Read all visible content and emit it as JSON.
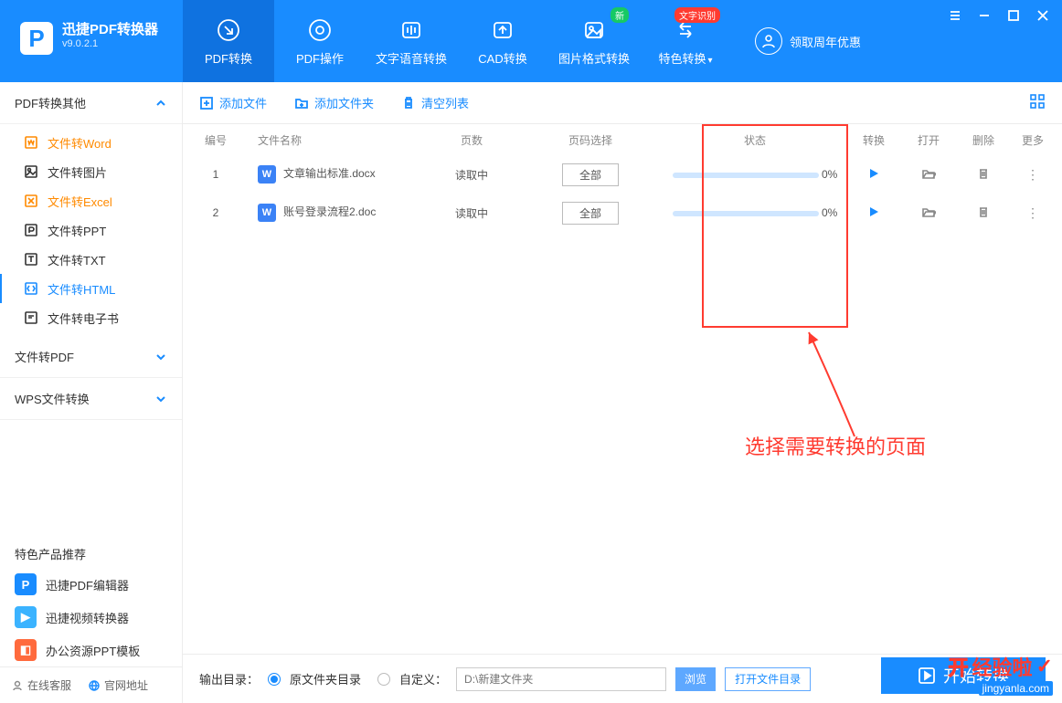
{
  "app": {
    "title": "迅捷PDF转换器",
    "version": "v9.0.2.1"
  },
  "nav": {
    "items": [
      {
        "label": "PDF转换"
      },
      {
        "label": "PDF操作"
      },
      {
        "label": "文字语音转换"
      },
      {
        "label": "CAD转换"
      },
      {
        "label": "图片格式转换"
      },
      {
        "label": "特色转换"
      }
    ],
    "badge_new": "新",
    "badge_ocr": "文字识别",
    "reward": "领取周年优惠"
  },
  "sidebar": {
    "groups": [
      {
        "label": "PDF转换其他"
      },
      {
        "label": "文件转PDF"
      },
      {
        "label": "WPS文件转换"
      }
    ],
    "items": [
      {
        "label": "文件转Word"
      },
      {
        "label": "文件转图片"
      },
      {
        "label": "文件转Excel"
      },
      {
        "label": "文件转PPT"
      },
      {
        "label": "文件转TXT"
      },
      {
        "label": "文件转HTML"
      },
      {
        "label": "文件转电子书"
      }
    ],
    "promo_title": "特色产品推荐",
    "promos": [
      {
        "label": "迅捷PDF编辑器",
        "color": "#198cff",
        "glyph": "P"
      },
      {
        "label": "迅捷视频转换器",
        "color": "#3bb3ff",
        "glyph": "▶"
      },
      {
        "label": "办公资源PPT模板",
        "color": "#ff6a3d",
        "glyph": "◧"
      }
    ],
    "footer": {
      "support": "在线客服",
      "site": "官网地址"
    }
  },
  "toolbar": {
    "add_file": "添加文件",
    "add_folder": "添加文件夹",
    "clear": "清空列表"
  },
  "table": {
    "headers": {
      "id": "编号",
      "name": "文件名称",
      "pages": "页数",
      "sel": "页码选择",
      "status": "状态",
      "convert": "转换",
      "open": "打开",
      "del": "删除",
      "more": "更多"
    },
    "rows": [
      {
        "id": "1",
        "name": "文章输出标准.docx",
        "pages": "读取中",
        "sel": "全部",
        "status": "0%"
      },
      {
        "id": "2",
        "name": "账号登录流程2.doc",
        "pages": "读取中",
        "sel": "全部",
        "status": "0%"
      }
    ]
  },
  "annotation": {
    "text": "选择需要转换的页面"
  },
  "bottom": {
    "out_label": "输出目录：",
    "opt_original": "原文件夹目录",
    "opt_custom": "自定义：",
    "placeholder": "D:\\新建文件夹",
    "browse": "浏览",
    "open_dir": "打开文件目录",
    "start": "开始转换"
  },
  "watermark": {
    "brand": "经验啦",
    "prefix": "开",
    "check": "✓",
    "url": "jingyanla.com"
  }
}
